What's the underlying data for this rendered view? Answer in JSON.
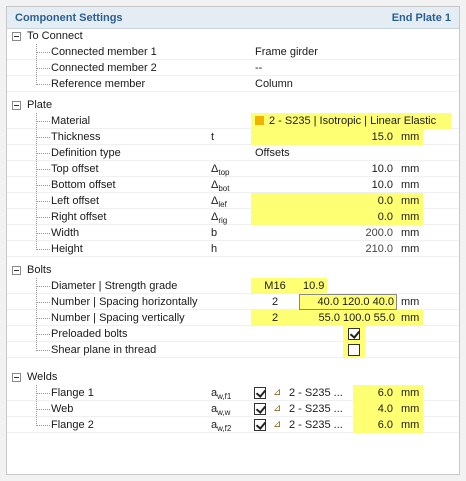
{
  "header": {
    "title": "Component Settings",
    "component": "End Plate 1"
  },
  "to_connect": {
    "title": "To Connect",
    "rows": [
      {
        "label": "Connected member 1",
        "value": "Frame girder"
      },
      {
        "label": "Connected member 2",
        "value": "--"
      },
      {
        "label": "Reference member",
        "value": "Column"
      }
    ]
  },
  "plate": {
    "title": "Plate",
    "material": {
      "label": "Material",
      "value": "2 - S235 | Isotropic | Linear Elastic",
      "swatch_color": "#f0b400"
    },
    "thickness": {
      "label": "Thickness",
      "symbol": "t",
      "value": "15.0",
      "unit": "mm"
    },
    "definition_type": {
      "label": "Definition type",
      "value": "Offsets"
    },
    "top_offset": {
      "label": "Top offset",
      "symbol": "Δ",
      "sub": "top",
      "value": "10.0",
      "unit": "mm"
    },
    "bottom_offset": {
      "label": "Bottom offset",
      "symbol": "Δ",
      "sub": "bot",
      "value": "10.0",
      "unit": "mm"
    },
    "left_offset": {
      "label": "Left offset",
      "symbol": "Δ",
      "sub": "lef",
      "value": "0.0",
      "unit": "mm"
    },
    "right_offset": {
      "label": "Right offset",
      "symbol": "Δ",
      "sub": "rig",
      "value": "0.0",
      "unit": "mm"
    },
    "width": {
      "label": "Width",
      "symbol": "b",
      "value": "200.0",
      "unit": "mm"
    },
    "height": {
      "label": "Height",
      "symbol": "h",
      "value": "210.0",
      "unit": "mm"
    }
  },
  "bolts": {
    "title": "Bolts",
    "diameter": {
      "label": "Diameter | Strength grade",
      "diameter": "M16",
      "grade": "10.9"
    },
    "horizontal": {
      "label": "Number | Spacing horizontally",
      "number": "2",
      "spacing": "40.0 120.0 40.0",
      "unit": "mm"
    },
    "vertical": {
      "label": "Number | Spacing vertically",
      "number": "2",
      "spacing": "55.0 100.0 55.0",
      "unit": "mm"
    },
    "preloaded": {
      "label": "Preloaded bolts",
      "checked": true
    },
    "shear_plane": {
      "label": "Shear plane in thread",
      "checked": false
    }
  },
  "welds": {
    "title": "Welds",
    "rows": [
      {
        "label": "Flange 1",
        "symbol": "a",
        "sub": "w,f1",
        "material": "2 - S235 ...",
        "value": "6.0",
        "unit": "mm"
      },
      {
        "label": "Web",
        "symbol": "a",
        "sub": "w,w",
        "material": "2 - S235 ...",
        "value": "4.0",
        "unit": "mm"
      },
      {
        "label": "Flange 2",
        "symbol": "a",
        "sub": "w,f2",
        "material": "2 - S235 ...",
        "value": "6.0",
        "unit": "mm"
      }
    ]
  }
}
